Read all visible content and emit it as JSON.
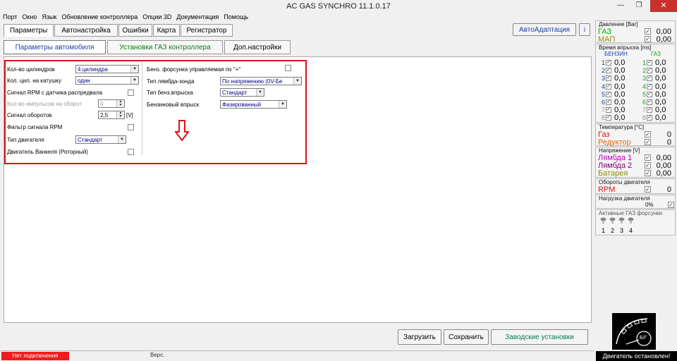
{
  "window": {
    "title": "AC GAS SYNCHRO  11.1.0.17"
  },
  "menu": [
    "Порт",
    "Окно",
    "Язык",
    "Обновление контроллера",
    "Опции 3D",
    "Документация",
    "Помощь"
  ],
  "main_tabs": [
    "Параметры",
    "Автонастройка",
    "Ошибки",
    "Карта",
    "Регистратор"
  ],
  "auto_adapt_label": "АвтоАдаптация",
  "sub_tabs": [
    "Параметры автомобиля",
    "Установки ГАЗ контроллера",
    "Доп.настройки"
  ],
  "left_params": [
    {
      "label": "Кол-во цилиндров",
      "value": "4 цилиндра"
    },
    {
      "label": "Кол. цил. на катушку",
      "value": "один"
    },
    {
      "label": "Сигнал RPM с датчика распредвала"
    },
    {
      "label": "Кол-во импульсов на оборот",
      "value": "0"
    },
    {
      "label": "Сигнал оборотов",
      "value": "2,5",
      "unit": "[V]"
    },
    {
      "label": "Фильтр сигнала RPM"
    },
    {
      "label": "Тип двигателя",
      "value": "Стандарт"
    },
    {
      "label": "Двигатель Ванкеля (Роторный)"
    }
  ],
  "right_params": [
    {
      "label": "Бенз. форсунка управляемая по \"+\""
    },
    {
      "label": "Тип лямбда-зонда",
      "value": "По напряжению  (0V-Бе"
    },
    {
      "label": "Тип бенз.впрыска",
      "value": "Стандарт"
    },
    {
      "label": "Бензиновый впрыск",
      "value": "Фазированный"
    }
  ],
  "buttons": {
    "load": "Загрузить",
    "save": "Сохранить",
    "factory": "Заводские установки"
  },
  "status": {
    "connection": "Нет подключения",
    "version_label": "Верс."
  },
  "sidebar": {
    "pressure": {
      "title": "Давление [Bar]",
      "rows": [
        {
          "name": "ГАЗ",
          "value": "0,00"
        },
        {
          "name": "МАП",
          "value": "0,00"
        }
      ]
    },
    "injection": {
      "title": "Время впрыска [ms]",
      "petrol_header": "БЕНЗИН",
      "gas_header": "ГАЗ",
      "cyl": [
        "1",
        "2",
        "3",
        "4",
        "5",
        "6",
        "7",
        "8"
      ],
      "value": "0,0"
    },
    "temperature": {
      "title": "Температура  [°C]",
      "rows": [
        {
          "name": "Газ",
          "value": "0"
        },
        {
          "name": "Редуктор",
          "value": "0"
        }
      ]
    },
    "voltage": {
      "title": "Напряжение [V]",
      "rows": [
        {
          "name": "Лямбда 1",
          "value": "0,00"
        },
        {
          "name": "Лямбда 2",
          "value": "0,00"
        },
        {
          "name": "Батарея",
          "value": "0,00"
        }
      ]
    },
    "rpm": {
      "title": "Обороты двигателя",
      "name": "RPM",
      "value": "0"
    },
    "load": {
      "title": "Нагрузка двигателя",
      "value": "0%"
    },
    "active": {
      "title": "Активные ГАЗ форсунки",
      "numbers": [
        "1",
        "2",
        "3",
        "4"
      ]
    },
    "logo_text": "Б/Г",
    "engine_status": "Двигатель остановлен!"
  },
  "colors": {
    "gas": "#00b000",
    "map": "#8b8b00",
    "red": "#e01010",
    "orange": "#e06a10",
    "magenta": "#c800c8",
    "purple": "#800080",
    "olive": "#8b8b00",
    "petrol_cyl": "#1a3ea8",
    "gas_cyl": "#00b000"
  }
}
